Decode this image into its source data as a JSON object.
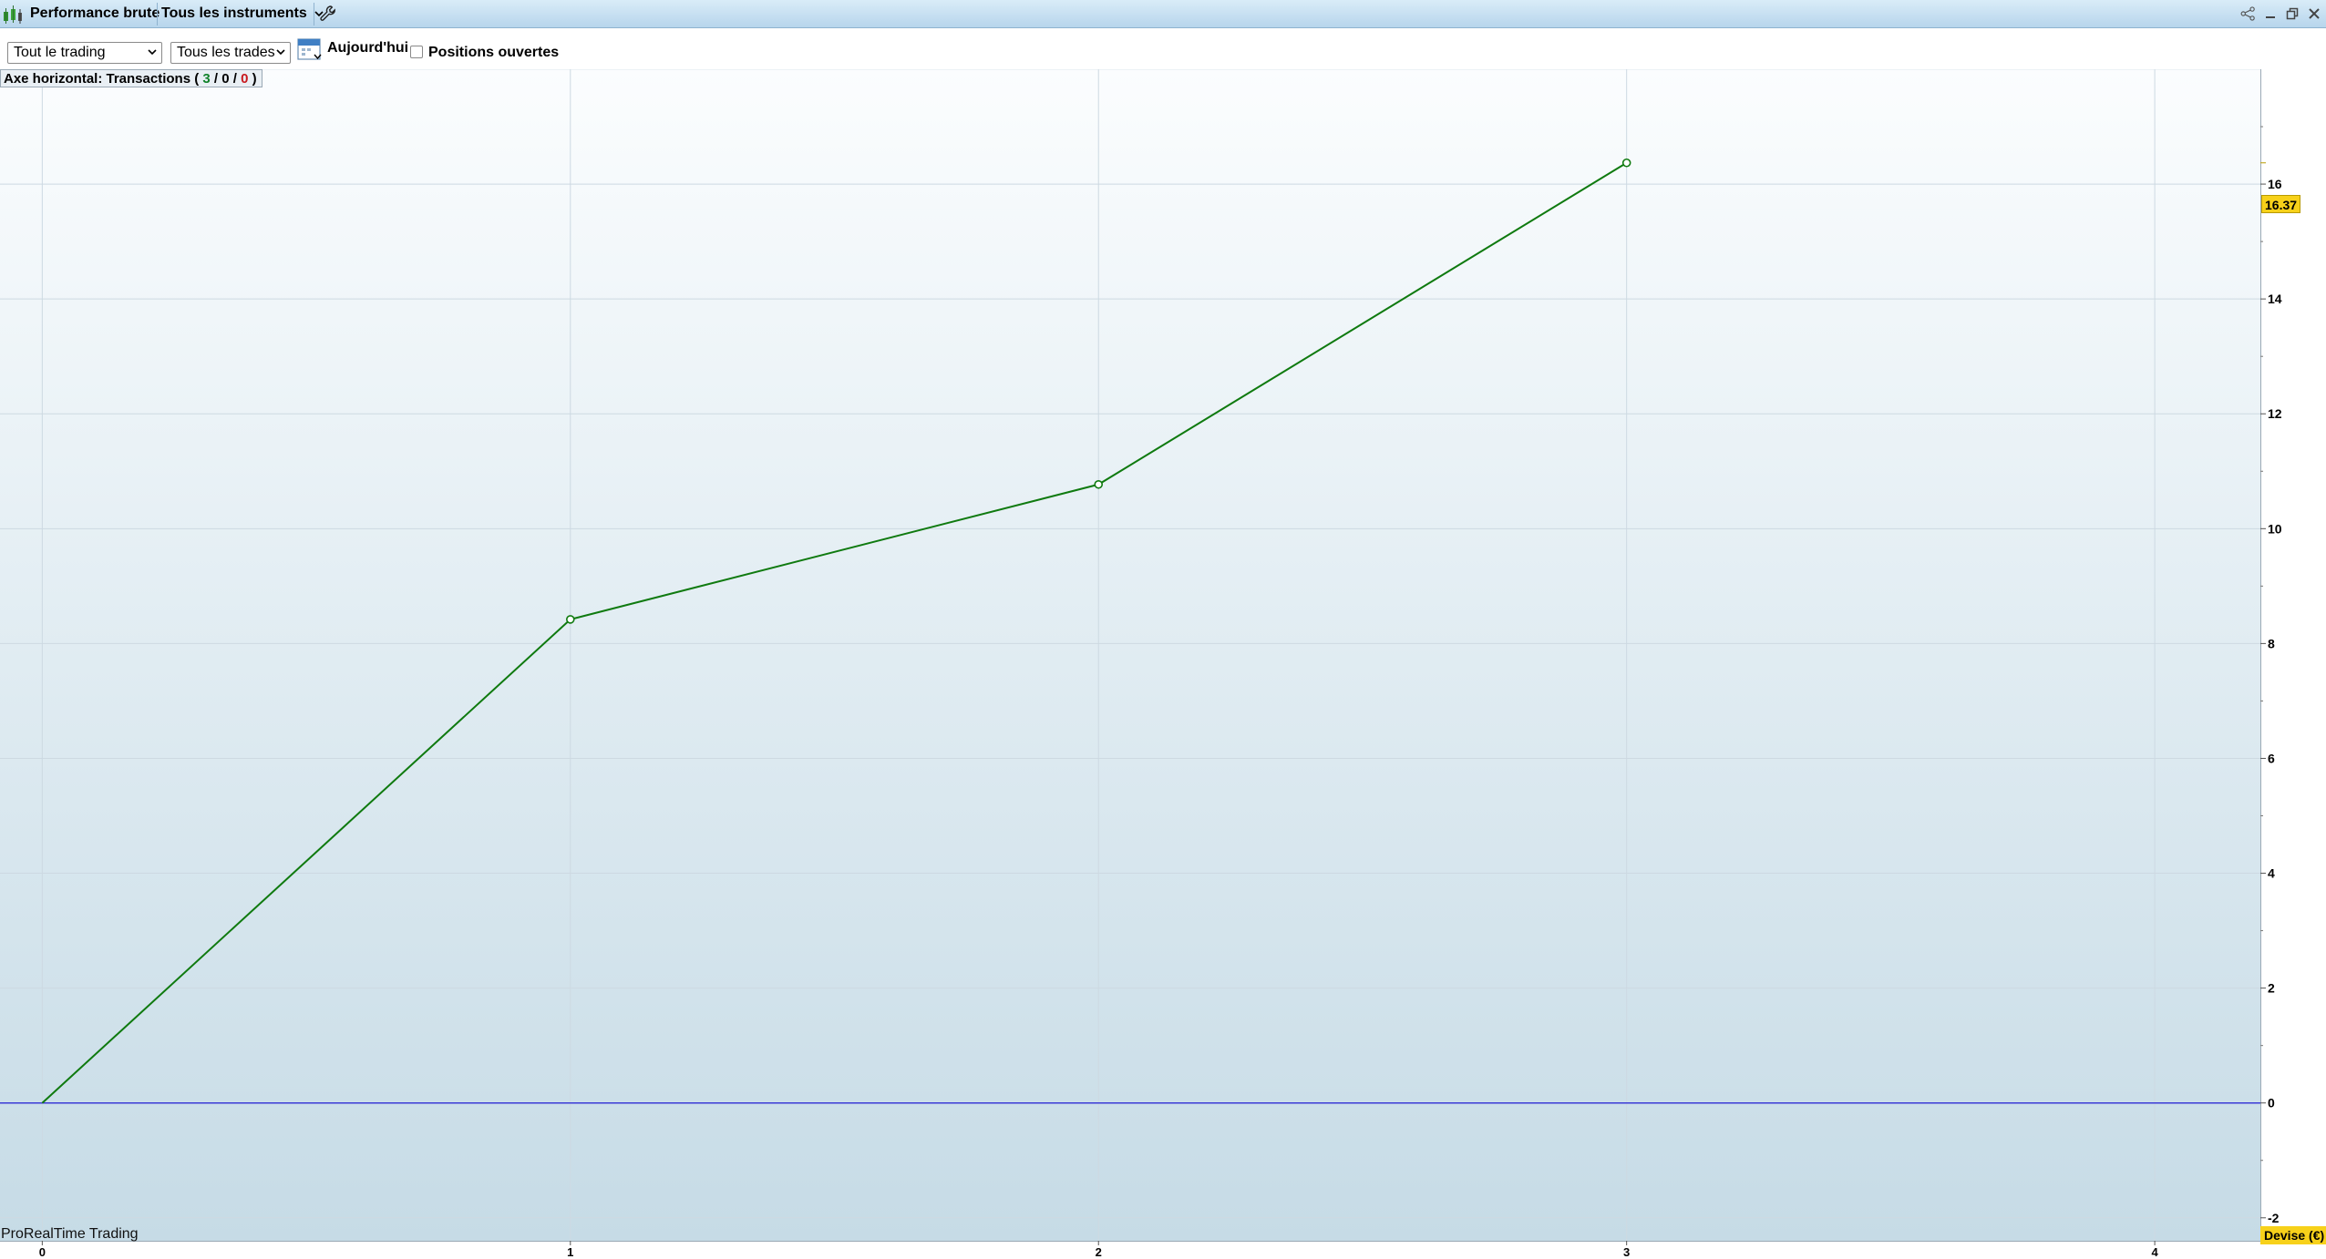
{
  "title_bar": {
    "title": "Performance brute",
    "instruments_menu": "Tous les instruments",
    "icons": [
      "candlestick-icon",
      "wrench-icon",
      "share-icon",
      "minimize-icon",
      "restore-icon",
      "close-icon"
    ]
  },
  "toolbar": {
    "period_select": "Tout le trading",
    "trades_select": "Tous les trades",
    "today_label": "Aujourd'hui",
    "open_positions_label": "Positions ouvertes",
    "open_positions_checked": false
  },
  "axis_info": {
    "label": "Axe horizontal: Transactions",
    "open_paren": "(",
    "total": "3",
    "sep1": "/",
    "neutral": "0",
    "sep2": "/",
    "losing": "0",
    "close_paren": ")"
  },
  "branding": "ProRealTime Trading",
  "last_value_badge": "16.37",
  "currency_badge": "Devise (€)",
  "colors": {
    "line": "#0f7a0f",
    "zero_line": "#3b3bd6",
    "badge": "#f7d11a",
    "bg_top": "#fbfdfe",
    "bg_bottom": "#c6dbe6"
  },
  "chart_data": {
    "type": "line",
    "title": "",
    "xlabel": "",
    "ylabel": "",
    "x": [
      0,
      1,
      2,
      3
    ],
    "y": [
      0,
      8.42,
      10.77,
      16.37
    ],
    "x_ticks": [
      "0",
      "1",
      "2",
      "3",
      "4"
    ],
    "y_ticks": [
      "-2",
      "0",
      "2",
      "4",
      "6",
      "8",
      "10",
      "12",
      "14",
      "16"
    ],
    "xlim": [
      -0.08,
      4.2
    ],
    "ylim": [
      -2.4,
      18.0
    ],
    "grid": true,
    "legend": "none"
  }
}
